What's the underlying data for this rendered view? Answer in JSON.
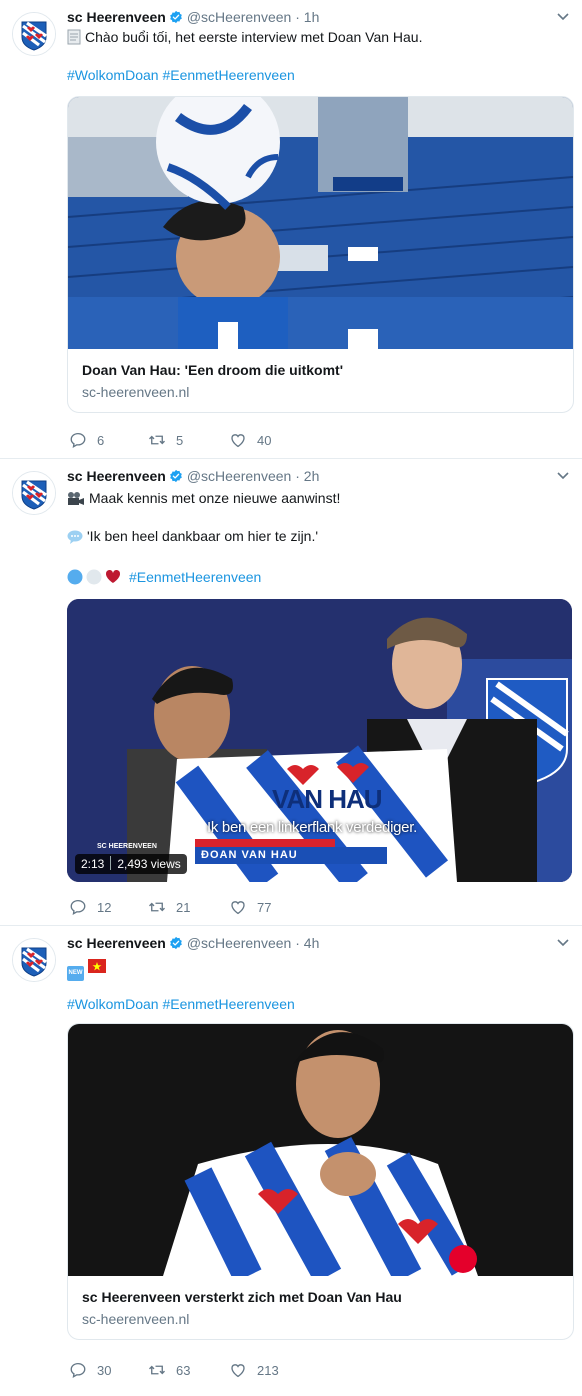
{
  "account": {
    "name": "sc Heerenveen",
    "handle": "@scHeerenveen"
  },
  "colors": {
    "accent": "#1b95e0",
    "text": "#14171a",
    "muted": "#657786",
    "border": "#e1e8ed"
  },
  "tweets": [
    {
      "time": "1h",
      "emoji": "page-facing-up-emoji",
      "text": "Chào buổi tối, het eerste interview met Doan Van Hau.",
      "hashtags": "#WolkomDoan #EenmetHeerenveen",
      "card": {
        "title": "Doan Van Hau: 'Een droom die uitkomt'",
        "domain": "sc-heerenveen.nl"
      },
      "stats": {
        "replies": "6",
        "retweets": "5",
        "likes": "40"
      }
    },
    {
      "time": "2h",
      "line1": "Maak kennis met onze nieuwe aanwinst!",
      "line1_emoji": "movie-camera-emoji",
      "line2": "'Ik ben heel dankbaar om hier te zijn.'",
      "line2_emoji": "speech-balloon-emoji",
      "hashtag": "#EenmetHeerenveen",
      "video": {
        "duration": "2:13",
        "views": "2,493 views",
        "subtitle": "Ik ben een linkerflank verdediger.",
        "lower_third": "ĐOAN VAN HAU",
        "shirt_text": "VAN HAU",
        "sc_tag": "SC HEERENVEEN"
      },
      "stats": {
        "replies": "12",
        "retweets": "21",
        "likes": "77"
      }
    },
    {
      "time": "4h",
      "emoji_text": "NEW",
      "hashtags": "#WolkomDoan #EenmetHeerenveen",
      "card": {
        "title": "sc Heerenveen versterkt zich met Doan Van Hau",
        "domain": "sc-heerenveen.nl"
      },
      "stats": {
        "replies": "30",
        "retweets": "63",
        "likes": "213"
      }
    }
  ]
}
